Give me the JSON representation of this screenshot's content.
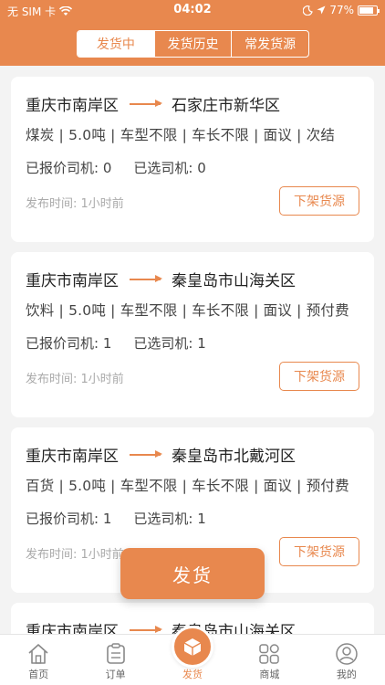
{
  "status_bar": {
    "carrier": "无 SIM 卡",
    "time": "04:02",
    "battery": "77%"
  },
  "header": {
    "tabs": [
      {
        "label": "发货中",
        "active": true
      },
      {
        "label": "发货历史",
        "active": false
      },
      {
        "label": "常发货源",
        "active": false
      }
    ]
  },
  "cards": [
    {
      "from": "重庆市南岸区",
      "to": "石家庄市新华区",
      "goods": "煤炭 | 5.0吨 | 车型不限 | 车长不限 | 面议 | 次结",
      "quoted": "已报价司机: 0",
      "selected": "已选司机: 0",
      "time": "发布时间: 1小时前",
      "action": "下架货源"
    },
    {
      "from": "重庆市南岸区",
      "to": "秦皇岛市山海关区",
      "goods": "饮料 | 5.0吨 | 车型不限 | 车长不限 | 面议 | 预付费",
      "quoted": "已报价司机: 1",
      "selected": "已选司机: 1",
      "time": "发布时间: 1小时前",
      "action": "下架货源"
    },
    {
      "from": "重庆市南岸区",
      "to": "秦皇岛市北戴河区",
      "goods": "百货 | 5.0吨 | 车型不限 | 车长不限 | 面议 | 预付费",
      "quoted": "已报价司机: 1",
      "selected": "已选司机: 1",
      "time": "发布时间: 1小时前",
      "action": "下架货源"
    },
    {
      "from": "重庆市南岸区",
      "to": "秦皇岛市山海关区"
    }
  ],
  "float_button": "发货",
  "tabbar": [
    {
      "label": "首页",
      "icon": "home-icon"
    },
    {
      "label": "订单",
      "icon": "order-icon"
    },
    {
      "label": "发货",
      "icon": "ship-box-icon"
    },
    {
      "label": "商城",
      "icon": "mall-icon"
    },
    {
      "label": "我的",
      "icon": "profile-icon"
    }
  ],
  "colors": {
    "accent": "#e8884e",
    "background": "#f3f3f3"
  }
}
